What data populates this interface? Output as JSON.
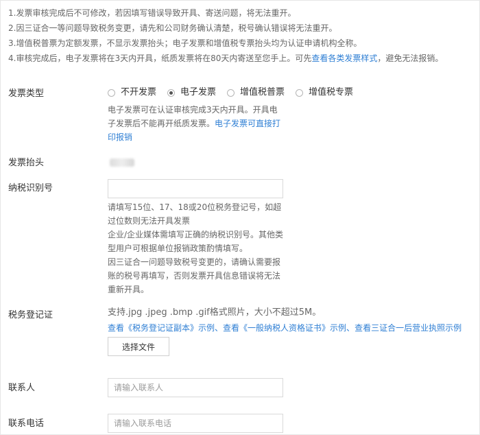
{
  "notice": {
    "line1": "1.发票审核完成后不可修改，若因填写错误导致开具、寄送问题，将无法重开。",
    "line2": "2.因三证合一等问题导致税务变更，请先和公司财务确认清楚，税号确认错误将无法重开。",
    "line3": "3.增值税普票为定额发票，不显示发票抬头；电子发票和增值税专票抬头均为认证申请机构全称。",
    "line4_prefix": "4.审核完成后，电子发票将在3天内开具，纸质发票将在80天内寄送至您手上。可先",
    "line4_link": "查看各类发票样式",
    "line4_suffix": "，避免无法报销。"
  },
  "invoice_type": {
    "label": "发票类型",
    "options": [
      {
        "label": "不开发票",
        "checked": false
      },
      {
        "label": "电子发票",
        "checked": true
      },
      {
        "label": "增值税普票",
        "checked": false
      },
      {
        "label": "增值税专票",
        "checked": false
      }
    ],
    "help_line1": "电子发票可在认证审核完成3天内开具。开具电",
    "help_line2_text": "子发票后不能再开纸质发票。",
    "help_line2_link": "电子发票可直接打",
    "help_line3_link": "印报销"
  },
  "invoice_title": {
    "label": "发票抬头"
  },
  "tax_id": {
    "label": "纳税识别号",
    "value": "",
    "help": [
      "请填写15位、17、18或20位税务登记号，如超",
      "过位数则无法开具发票",
      "企业/企业媒体需填写正确的纳税识别号。其他类",
      "型用户可根据单位报销政策酌情填写。",
      "因三证合一问题导致税号变更的，请确认需要报",
      "账的税号再填写，否则发票开具信息错误将无法",
      "重新开具。"
    ]
  },
  "tax_cert": {
    "label": "税务登记证",
    "format_hint": "支持.jpg .jpeg .bmp .gif格式照片，大小不超过5M。",
    "example1": "查看《税务登记证副本》示例",
    "example2": "查看《一般纳税人资格证书》示例",
    "example3": "查看三证合一后营业执照示例",
    "separator": "、",
    "file_button": "选择文件"
  },
  "contact": {
    "label": "联系人",
    "placeholder": "请输入联系人"
  },
  "phone": {
    "label": "联系电话",
    "placeholder": "请输入联系电话"
  }
}
